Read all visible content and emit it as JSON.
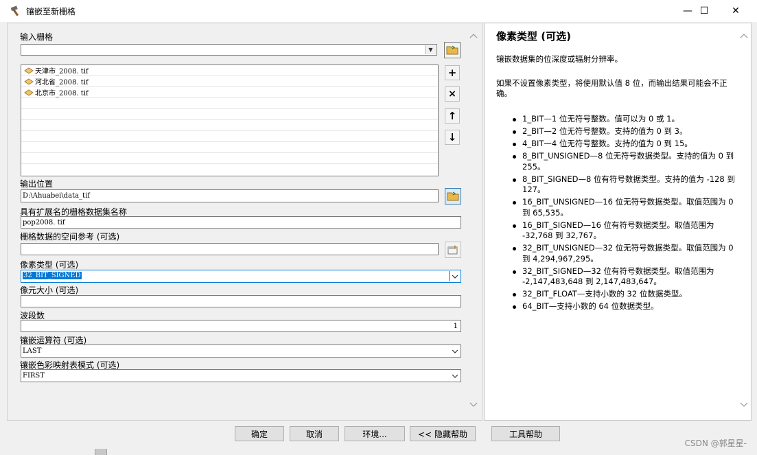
{
  "window": {
    "title": "镶嵌至新栅格",
    "minimize_glyph": "—",
    "maximize_glyph": "☐",
    "close_glyph": "✕"
  },
  "form": {
    "input_rasters_label": "输入栅格",
    "input_rasters_value": "",
    "input_rasters_list": [
      {
        "name": "天津市_2008. tif",
        "icon": "raster-layer-icon"
      },
      {
        "name": "河北省_2008. tif",
        "icon": "raster-layer-icon"
      },
      {
        "name": "北京市_2008. tif",
        "icon": "raster-layer-icon"
      }
    ],
    "output_location_label": "输出位置",
    "output_location_value": "D:\\Ahuabei\\data_tif",
    "dataset_name_label": "具有扩展名的栅格数据集名称",
    "dataset_name_value": "pop2008. tif",
    "spatial_ref_label": "栅格数据的空间参考 (可选)",
    "spatial_ref_value": "",
    "pixel_type_label": "像素类型 (可选)",
    "pixel_type_value": "32_BIT_SIGNED",
    "cellsize_label": "像元大小 (可选)",
    "cellsize_value": "",
    "bands_label": "波段数",
    "bands_value": "1",
    "mosaic_operator_label": "镶嵌运算符 (可选)",
    "mosaic_operator_value": "LAST",
    "colormap_mode_label": "镶嵌色彩映射表模式 (可选)",
    "colormap_mode_value": "FIRST"
  },
  "side_buttons": {
    "add": "+",
    "remove": "×",
    "up": "↑",
    "down": "↓"
  },
  "help": {
    "title": "像素类型 (可选)",
    "intro": "镶嵌数据集的位深度或辐射分辨率。",
    "note": "如果不设置像素类型，将使用默认值 8 位，而输出结果可能会不正确。",
    "items": [
      "1_BIT—1 位无符号整数。值可以为 0 或 1。",
      "2_BIT—2 位无符号整数。支持的值为 0 到 3。",
      "4_BIT—4 位无符号整数。支持的值为 0 到 15。",
      "8_BIT_UNSIGNED—8 位无符号数据类型。支持的值为 0 到 255。",
      "8_BIT_SIGNED—8 位有符号数据类型。支持的值为 -128 到 127。",
      "16_BIT_UNSIGNED—16 位无符号数据类型。取值范围为 0 到 65,535。",
      "16_BIT_SIGNED—16 位有符号数据类型。取值范围为 -32,768 到 32,767。",
      "32_BIT_UNSIGNED—32 位无符号数据类型。取值范围为 0 到 4,294,967,295。",
      "32_BIT_SIGNED—32 位有符号数据类型。取值范围为 -2,147,483,648 到 2,147,483,647。",
      "32_BIT_FLOAT—支持小数的 32 位数据类型。",
      "64_BIT—支持小数的 64 位数据类型。"
    ]
  },
  "buttons": {
    "ok": "确定",
    "cancel": "取消",
    "environments": "环境...",
    "hide_help": "<< 隐藏帮助",
    "tool_help": "工具帮助"
  },
  "watermark": "CSDN @郭星星-",
  "colors": {
    "selection": "#0078d7",
    "title_bar": "#ffffff",
    "dialog_bg": "#f0f0f0",
    "folder_yellow": "#e8b84a"
  }
}
